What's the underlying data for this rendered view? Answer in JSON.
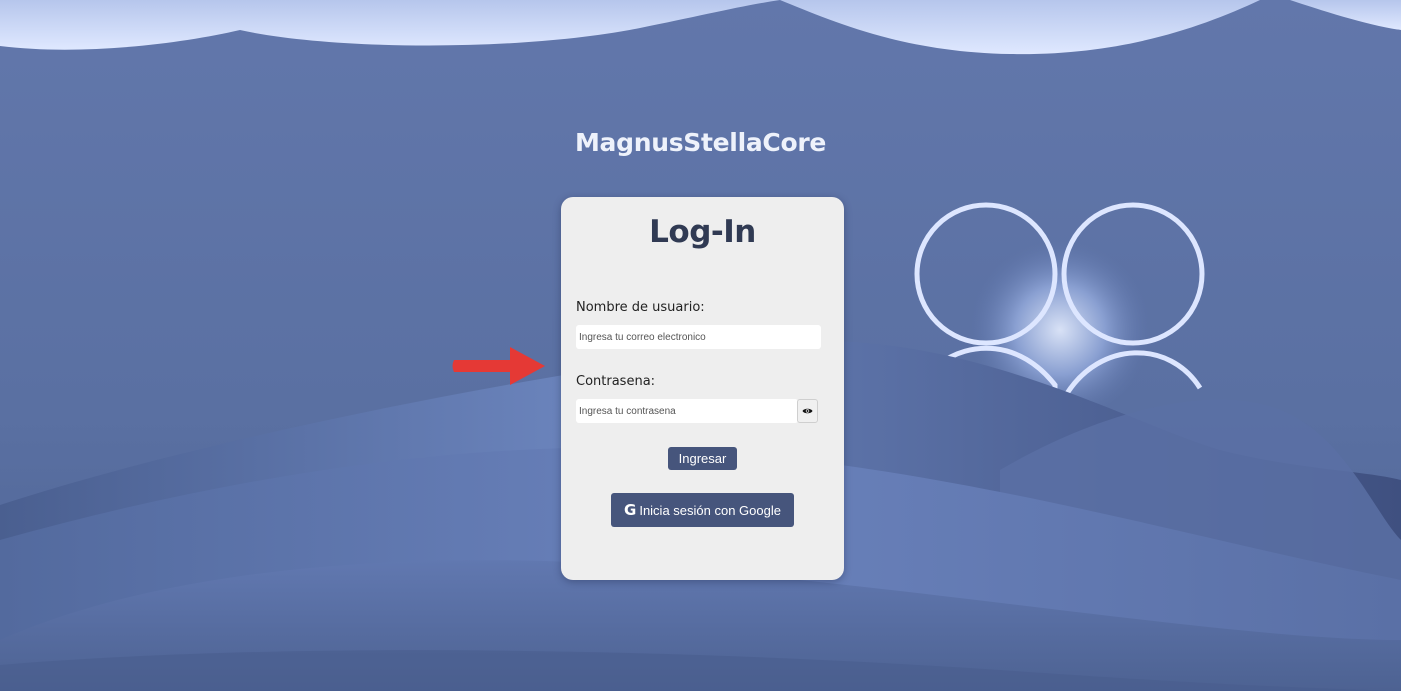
{
  "app": {
    "title": "MagnusStellaCore"
  },
  "login": {
    "heading": "Log-In",
    "username_label": "Nombre de usuario:",
    "username_placeholder": "Ingresa tu correo electronico",
    "password_label": "Contrasena:",
    "password_placeholder": "Ingresa tu contrasena",
    "toggle_password_icon": "eye-icon",
    "submit_label": "Ingresar",
    "google_icon": "google-icon",
    "google_label": "Inicia sesión con Google"
  },
  "colors": {
    "background": "#5a72a4",
    "card": "#eeeeee",
    "button": "#46557c",
    "heading": "#303a53",
    "annotation_arrow": "#e53935"
  }
}
